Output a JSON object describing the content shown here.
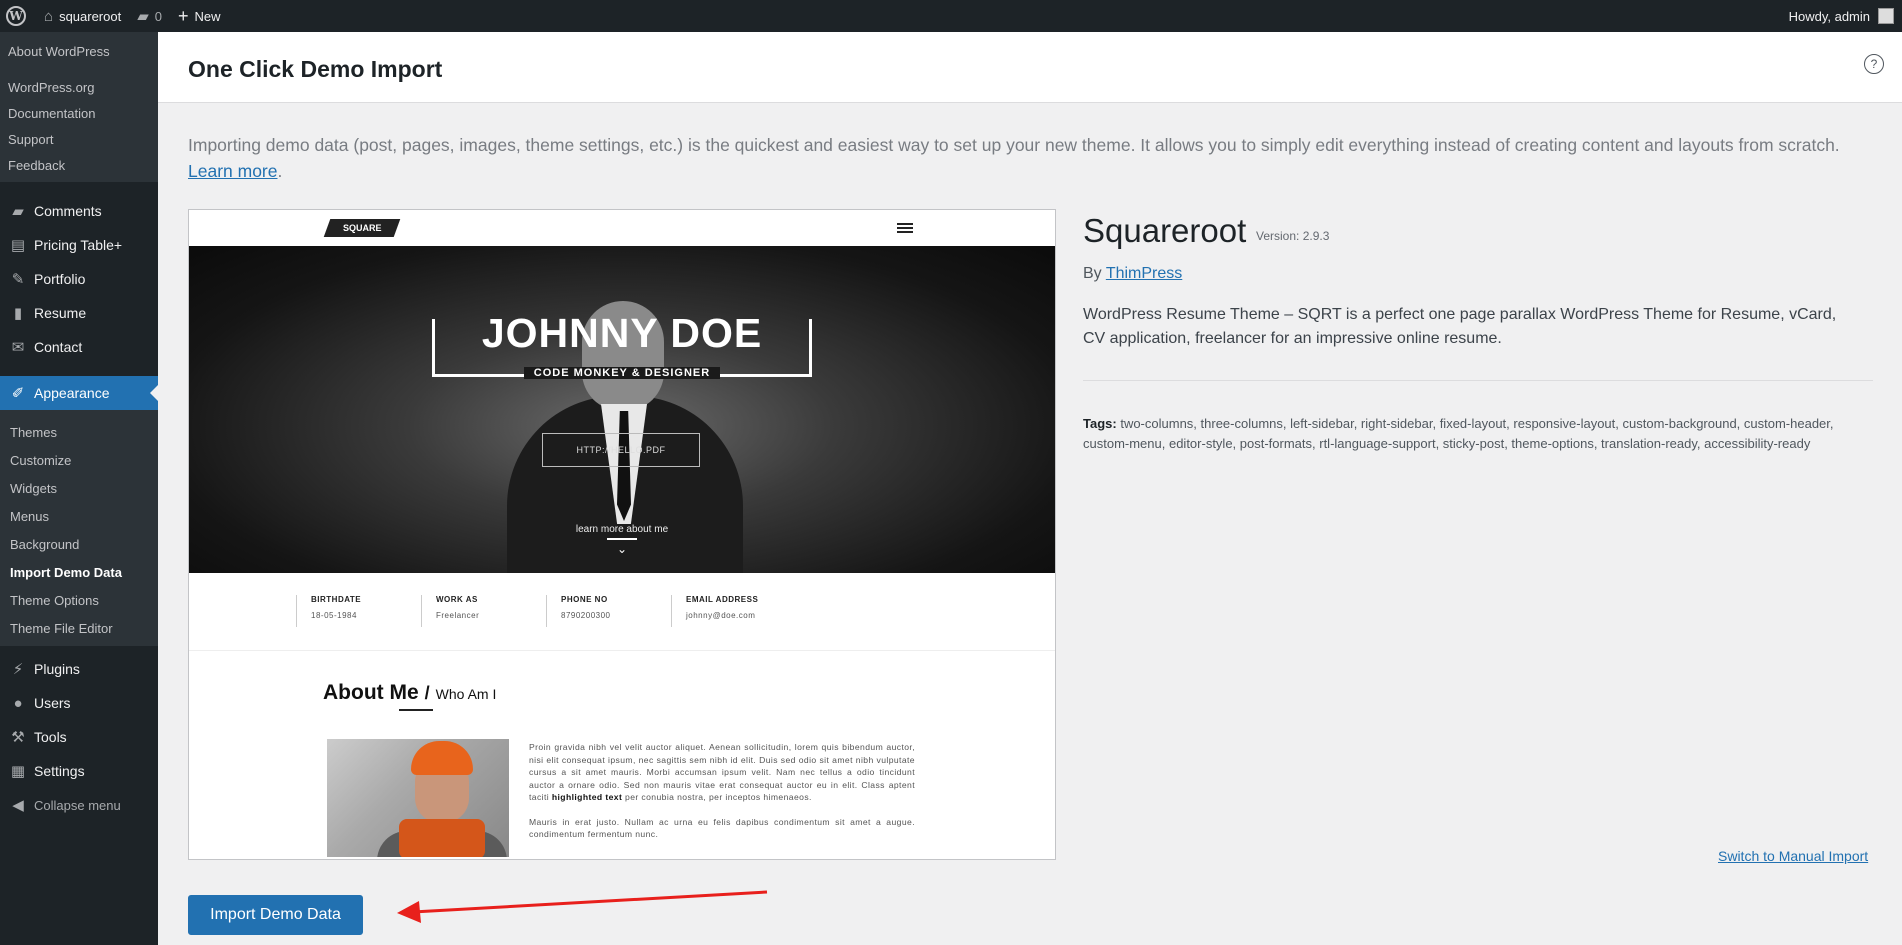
{
  "adminbar": {
    "site_name": "squareroot",
    "comments_count": "0",
    "new_label": "New",
    "howdy": "Howdy, admin"
  },
  "sidebar": {
    "about_group": [
      "About WordPress"
    ],
    "links_group": [
      "WordPress.org",
      "Documentation",
      "Support",
      "Feedback"
    ],
    "menu": [
      {
        "label": "Comments",
        "icon": "comment-icon"
      },
      {
        "label": "Pricing Table+",
        "icon": "table-icon"
      },
      {
        "label": "Portfolio",
        "icon": "pin-icon"
      },
      {
        "label": "Resume",
        "icon": "book-icon"
      },
      {
        "label": "Contact",
        "icon": "mail-icon"
      }
    ],
    "appearance": "Appearance",
    "appearance_sub": [
      "Themes",
      "Customize",
      "Widgets",
      "Menus",
      "Background",
      "Import Demo Data",
      "Theme Options",
      "Theme File Editor"
    ],
    "menu2": [
      {
        "label": "Plugins",
        "icon": "plugin-icon"
      },
      {
        "label": "Users",
        "icon": "user-icon"
      },
      {
        "label": "Tools",
        "icon": "wrench-icon"
      },
      {
        "label": "Settings",
        "icon": "settings-icon"
      }
    ],
    "collapse": "Collapse menu"
  },
  "page": {
    "title": "One Click Demo Import",
    "help": "?",
    "intro": "Importing demo data (post, pages, images, theme settings, etc.) is the quickest and easiest way to set up your new theme. It allows you to simply edit everything instead of creating content and layouts from scratch. ",
    "intro_link": "Learn more",
    "intro_end": "."
  },
  "preview": {
    "logo": "SQUARE",
    "hero_name": "JOHNNY DOE",
    "hero_sub": "CODE MONKEY & DESIGNER",
    "hero_link": "HTTP://HELLO.PDF",
    "hero_learn": "learn more about me",
    "info": [
      {
        "label": "BIRTHDATE",
        "value": "18-05-1984"
      },
      {
        "label": "WORK AS",
        "value": "Freelancer"
      },
      {
        "label": "PHONE NO",
        "value": "8790200300"
      },
      {
        "label": "EMAIL ADDRESS",
        "value": "johnny@doe.com"
      }
    ],
    "about_title": "About Me",
    "about_slash": "/",
    "about_who": "Who Am I",
    "about_p1_a": "Proin gravida nibh vel velit auctor aliquet. Aenean sollicitudin, lorem quis bibendum auctor, nisi elit consequat ipsum, nec sagittis sem nibh id elit. Duis sed odio sit amet nibh vulputate cursus a sit amet mauris. Morbi accumsan ipsum velit. Nam nec tellus a odio tincidunt auctor a ornare odio. Sed non mauris vitae erat consequat auctor eu in elit. Class aptent taciti ",
    "about_p1_bold": "highlighted text",
    "about_p1_b": " per conubia nostra, per inceptos himenaeos.",
    "about_p2": "Mauris in erat justo. Nullam ac urna eu felis dapibus condimentum sit amet a augue. condimentum fermentum nunc."
  },
  "theme": {
    "name": "Squareroot",
    "version": "Version: 2.9.3",
    "by": "By ",
    "author": "ThimPress",
    "description": "WordPress Resume Theme – SQRT is a perfect one page parallax WordPress Theme for Resume, vCard, CV application, freelancer for an impressive online resume.",
    "tags_label": "Tags:",
    "tags": " two-columns, three-columns, left-sidebar, right-sidebar, fixed-layout, responsive-layout, custom-background, custom-header, custom-menu, editor-style, post-formats, rtl-language-support, sticky-post, theme-options, translation-ready, accessibility-ready",
    "switch_link": "Switch to Manual Import"
  },
  "actions": {
    "import_button": "Import Demo Data"
  },
  "colors": {
    "arrow": "#e8201c",
    "primary": "#2271b1"
  }
}
